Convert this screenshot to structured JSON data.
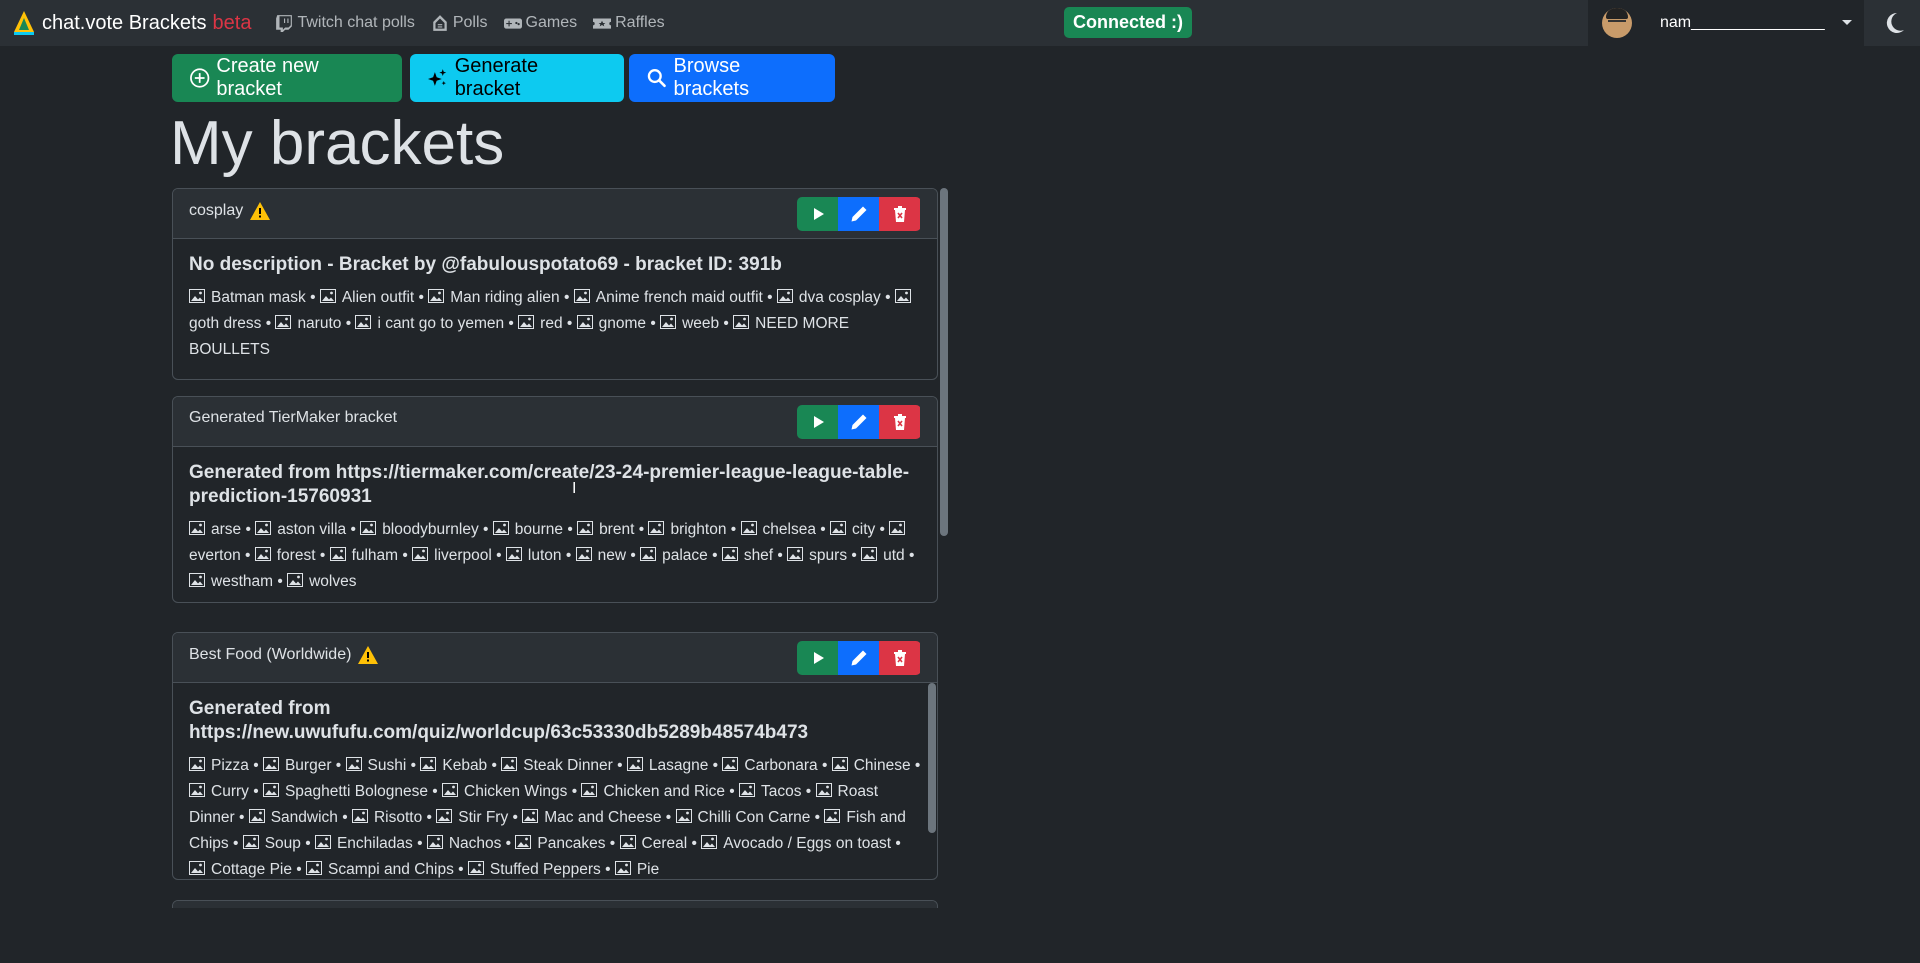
{
  "navbar": {
    "brand": "chat.vote Brackets",
    "beta": "beta",
    "links": [
      {
        "label": "Twitch chat polls",
        "icon": "twitch-icon"
      },
      {
        "label": "Polls",
        "icon": "poll-icon"
      },
      {
        "label": "Games",
        "icon": "gamepad-icon"
      },
      {
        "label": "Raffles",
        "icon": "ticket-icon"
      }
    ],
    "status": "Connected :)",
    "username": "nam_______________"
  },
  "actions": {
    "create": "Create new bracket",
    "generate": "Generate bracket",
    "browse": "Browse brackets"
  },
  "page_title": "My brackets",
  "brackets": [
    {
      "name": "cosplay",
      "warning": true,
      "description": "No description - Bracket by @fabulouspotato69 - bracket ID: 391b",
      "items": [
        "Batman mask",
        "Alien outfit",
        "Man riding alien",
        "Anime french maid outfit",
        "dva cosplay",
        "goth dress",
        "naruto",
        "i cant go to yemen",
        "red",
        "gnome",
        "weeb",
        "NEED MORE BOULLETS"
      ]
    },
    {
      "name": "Generated TierMaker bracket",
      "warning": false,
      "description": "Generated from https://tiermaker.com/create/23-24-premier-league-league-table-prediction-15760931",
      "items": [
        "arse",
        "aston villa",
        "bloodyburnley",
        "bourne",
        "brent",
        "brighton",
        "chelsea",
        "city",
        "everton",
        "forest",
        "fulham",
        "liverpool",
        "luton",
        "new",
        "palace",
        "shef",
        "spurs",
        "utd",
        "westham",
        "wolves"
      ]
    },
    {
      "name": "Best Food (Worldwide)",
      "warning": true,
      "description": "Generated from https://new.uwufufu.com/quiz/worldcup/63c53330db5289b48574b473",
      "items": [
        "Pizza",
        "Burger",
        "Sushi",
        "Kebab",
        "Steak Dinner",
        "Lasagne",
        "Carbonara",
        "Chinese",
        "Curry",
        "Spaghetti Bolognese",
        "Chicken Wings",
        "Chicken and Rice",
        "Tacos",
        "Roast Dinner",
        "Sandwich",
        "Risotto",
        "Stir Fry",
        "Mac and Cheese",
        "Chilli Con Carne",
        "Fish and Chips",
        "Soup",
        "Enchiladas",
        "Nachos",
        "Pancakes",
        "Cereal",
        "Avocado / Eggs on toast",
        "Cottage Pie",
        "Scampi and Chips",
        "Stuffed Peppers",
        "Pie"
      ]
    }
  ],
  "colors": {
    "success": "#198754",
    "primary": "#0d6efd",
    "info": "#0dcaf0",
    "danger": "#dc3545",
    "warning": "#ffc107"
  }
}
